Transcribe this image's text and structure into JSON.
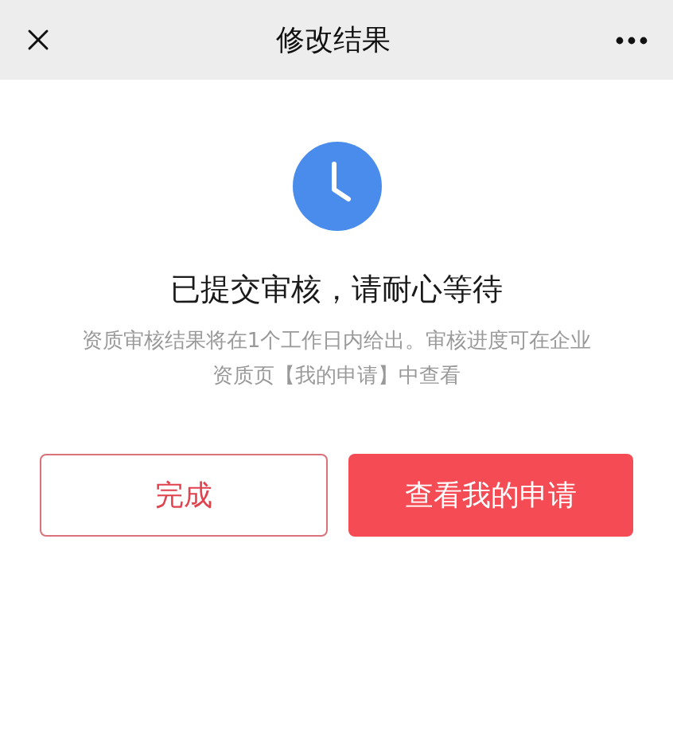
{
  "header": {
    "title": "修改结果"
  },
  "status": {
    "title": "已提交审核，请耐心等待",
    "description": "资质审核结果将在1个工作日内给出。审核进度可在企业资质页【我的申请】中查看"
  },
  "buttons": [
    {
      "label": "完成",
      "kind": "outline"
    },
    {
      "label": "查看我的申请",
      "kind": "primary"
    }
  ]
}
